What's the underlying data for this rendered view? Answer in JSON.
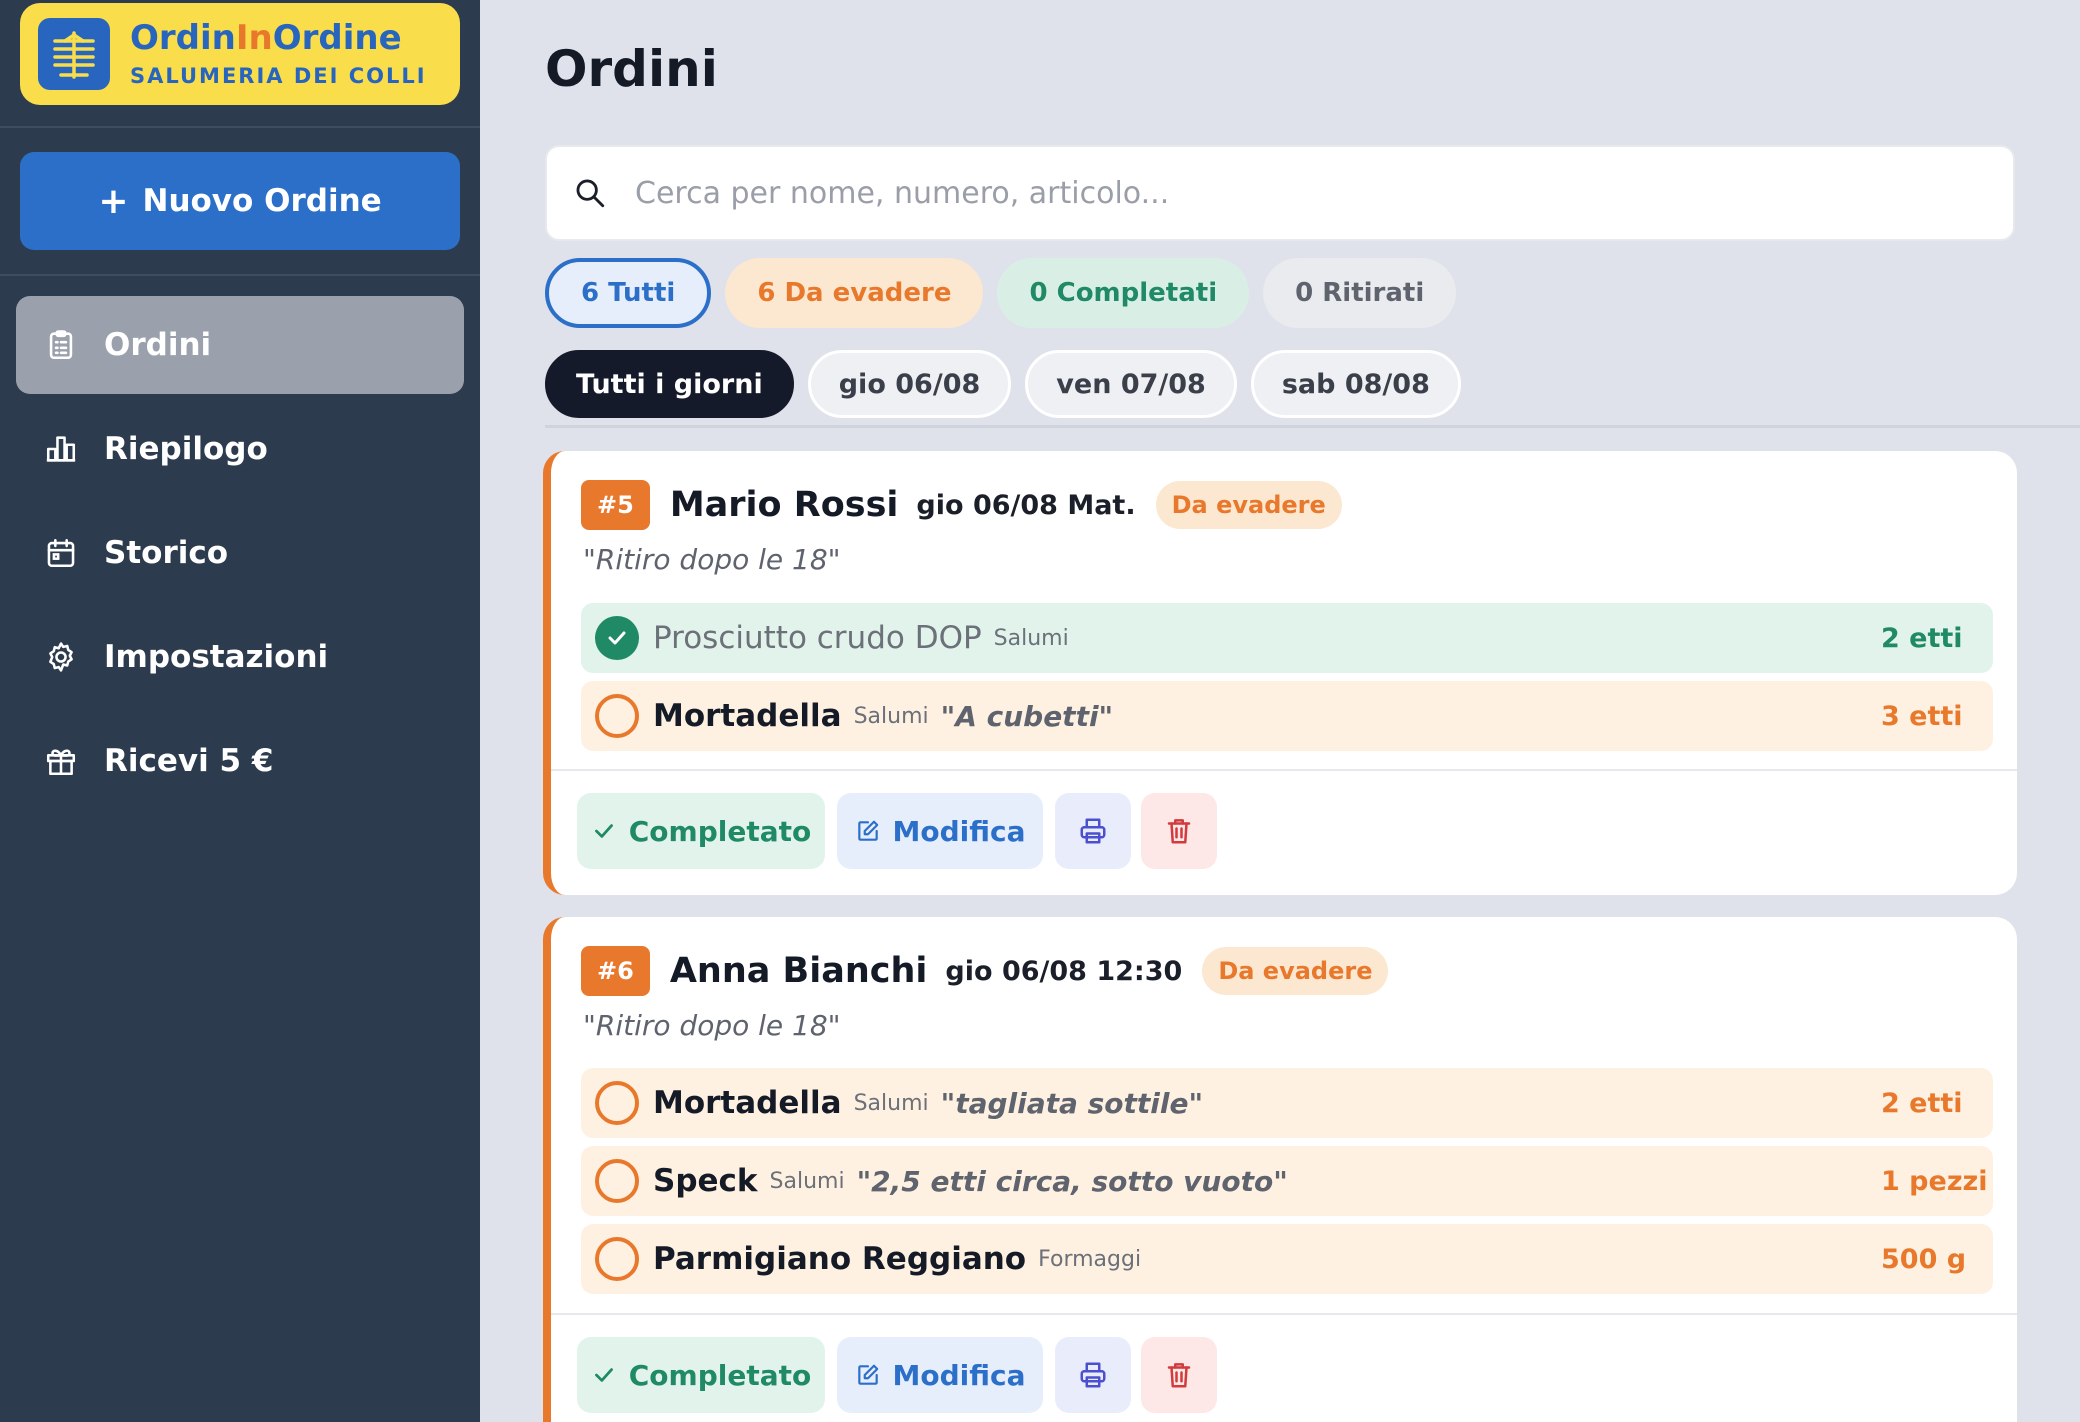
{
  "brand": {
    "name_a": "Ordin",
    "name_b": "In",
    "name_c": "Ordine",
    "subtitle": "SALUMERIA DEI COLLI"
  },
  "sidebar": {
    "new_order_label": "Nuovo Ordine",
    "items": [
      {
        "label": "Ordini",
        "icon": "clipboard-icon",
        "active": true
      },
      {
        "label": "Riepilogo",
        "icon": "bar-chart-icon"
      },
      {
        "label": "Storico",
        "icon": "calendar-icon"
      },
      {
        "label": "Impostazioni",
        "icon": "gear-icon"
      },
      {
        "label": "Ricevi 5 €",
        "icon": "gift-icon"
      }
    ]
  },
  "main": {
    "title": "Ordini",
    "search_placeholder": "Cerca per nome, numero, articolo...",
    "status_filters": [
      {
        "label": "6 Tutti",
        "active": true
      },
      {
        "label": "6 Da evadere"
      },
      {
        "label": "0 Completati"
      },
      {
        "label": "0 Ritirati"
      }
    ],
    "day_filters": [
      {
        "label": "Tutti i giorni",
        "active": true
      },
      {
        "label": "gio 06/08"
      },
      {
        "label": "ven 07/08"
      },
      {
        "label": "sab 08/08"
      }
    ]
  },
  "orders": [
    {
      "number": "#5",
      "customer": "Mario Rossi",
      "time": "gio 06/08 Mat.",
      "status": "Da evadere",
      "note": "\"Ritiro dopo le 18\"",
      "items": [
        {
          "name": "Prosciutto crudo DOP",
          "category": "Salumi",
          "note": "",
          "qty": "2 etti",
          "done": true
        },
        {
          "name": "Mortadella",
          "category": "Salumi",
          "note": "\"A cubetti\"",
          "qty": "3 etti",
          "done": false
        }
      ]
    },
    {
      "number": "#6",
      "customer": "Anna Bianchi",
      "time": "gio 06/08 12:30",
      "status": "Da evadere",
      "note": "\"Ritiro dopo le 18\"",
      "items": [
        {
          "name": "Mortadella",
          "category": "Salumi",
          "note": "\"tagliata sottile\"",
          "qty": "2 etti",
          "done": false
        },
        {
          "name": "Speck",
          "category": "Salumi",
          "note": "\"2,5 etti circa, sotto vuoto\"",
          "qty": "1 pezzi",
          "done": false
        },
        {
          "name": "Parmigiano Reggiano",
          "category": "Formaggi",
          "note": "",
          "qty": "500 g",
          "done": false
        }
      ]
    }
  ],
  "actions": {
    "complete_label": "Completato",
    "edit_label": "Modifica"
  },
  "colors": {
    "sidebar": "#2d3b4e",
    "brand_yellow": "#f9dd4a",
    "primary": "#2c6fc8",
    "pending": "#e8792c",
    "success": "#1f8a65"
  }
}
